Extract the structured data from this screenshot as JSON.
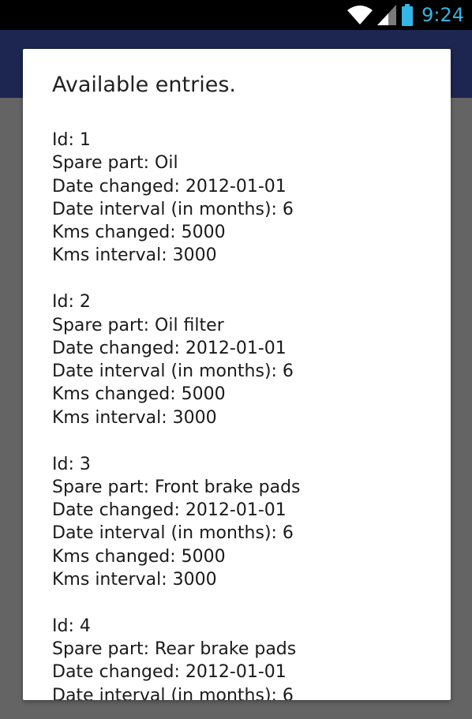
{
  "status_bar": {
    "time": "9:24",
    "icons": [
      "wifi-icon",
      "signal-icon",
      "battery-icon"
    ],
    "accent_color": "#33b5e5"
  },
  "app_bar": {
    "color": "#1c2650"
  },
  "dialog": {
    "title": "Available entries.",
    "entries": [
      {
        "id": "Id: 1",
        "spare_part": "Spare part: Oil",
        "date_changed": "Date changed: 2012-01-01",
        "date_interval": "Date interval (in months): 6",
        "kms_changed": "Kms changed: 5000",
        "kms_interval": "Kms interval: 3000"
      },
      {
        "id": "Id: 2",
        "spare_part": "Spare part: Oil filter",
        "date_changed": "Date changed: 2012-01-01",
        "date_interval": "Date interval (in months): 6",
        "kms_changed": "Kms changed: 5000",
        "kms_interval": "Kms interval: 3000"
      },
      {
        "id": "Id: 3",
        "spare_part": "Spare part: Front brake pads",
        "date_changed": "Date changed: 2012-01-01",
        "date_interval": "Date interval (in months): 6",
        "kms_changed": "Kms changed: 5000",
        "kms_interval": "Kms interval: 3000"
      },
      {
        "id": "Id: 4",
        "spare_part": "Spare part: Rear brake pads",
        "date_changed": "Date changed: 2012-01-01",
        "date_interval": "Date interval (in months): 6"
      }
    ]
  }
}
